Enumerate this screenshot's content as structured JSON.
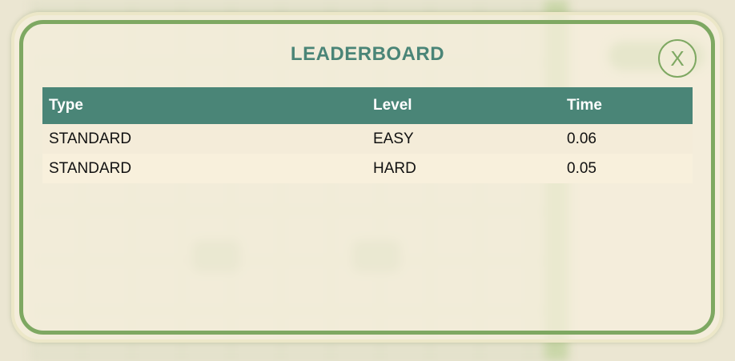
{
  "leaderboard": {
    "title": "LEADERBOARD",
    "close_label": "X",
    "columns": [
      "Type",
      "Level",
      "Time"
    ],
    "rows": [
      {
        "type": "STANDARD",
        "level": "EASY",
        "time": "0.06"
      },
      {
        "type": "STANDARD",
        "level": "HARD",
        "time": "0.05"
      }
    ]
  }
}
